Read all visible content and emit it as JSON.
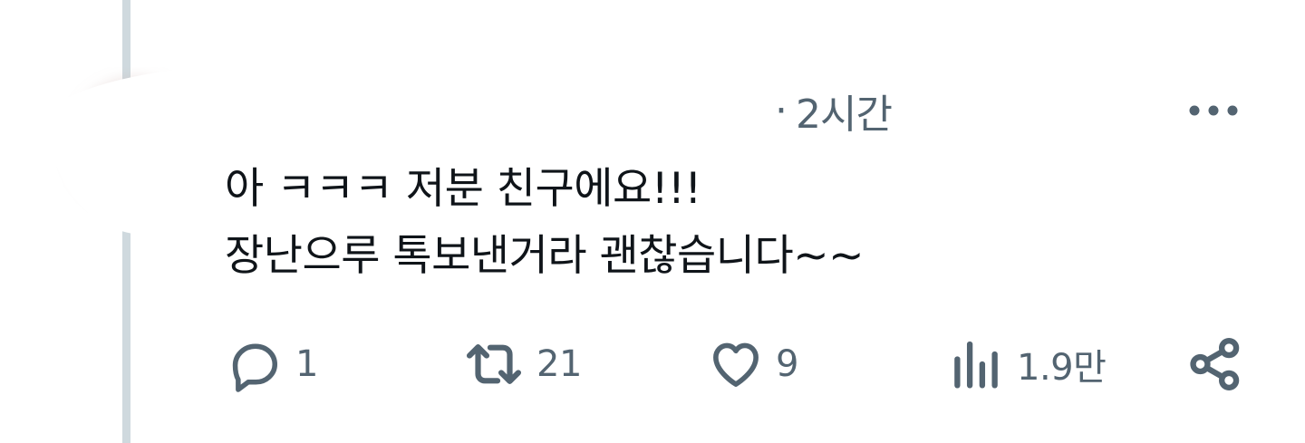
{
  "tweet": {
    "time": "2시간",
    "separator": "·",
    "lines": [
      "아 ㅋㅋㅋ 저분 친구에요!!!",
      "장난으루 톡보낸거라 괜찮습니다~~"
    ]
  },
  "actions": {
    "reply_count": "1",
    "retweet_count": "21",
    "like_count": "9",
    "views_count": "1.9만"
  },
  "icons": {
    "reply": "reply-icon",
    "retweet": "retweet-icon",
    "like": "heart-icon",
    "views": "views-icon",
    "share": "share-icon",
    "more": "more-icon"
  },
  "colors": {
    "text": "#0f1419",
    "secondary": "#536471",
    "thread_line": "#cfd9de"
  }
}
